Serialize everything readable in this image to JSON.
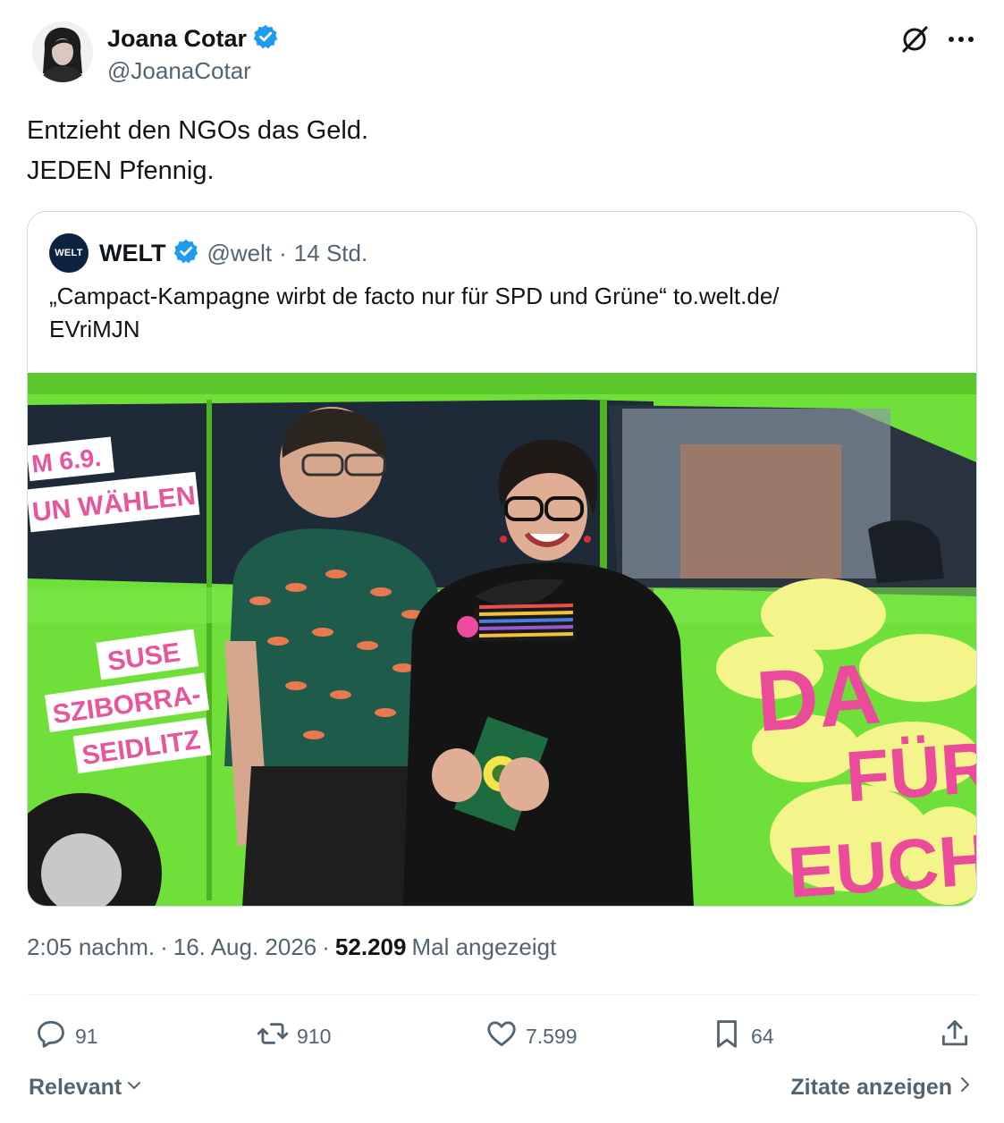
{
  "author": {
    "name": "Joana Cotar",
    "handle": "@JoanaCotar",
    "verified": true
  },
  "tweet": {
    "line1": "Entzieht den NGOs das Geld.",
    "line2": "JEDEN Pfennig."
  },
  "quoted": {
    "logo_text": "WELT",
    "name": "WELT",
    "handle": "@welt",
    "separator": "·",
    "age": "14 Std.",
    "text_line1": "„Campact-Kampagne wirbt de facto nur für SPD und Grüne“ to.welt.de/",
    "text_line2": "EVriMJN",
    "image": {
      "poster_date": "M 6.9.",
      "poster_vote": "UN WÄHLEN",
      "poster_name1": "SUSE",
      "poster_name2": "SZIBORRA-",
      "poster_name3": "SEIDLITZ",
      "slogan1": "DA",
      "slogan2": "FÜR",
      "slogan3": "EUCH."
    }
  },
  "meta": {
    "time": "2:05 nachm.",
    "sep1": "·",
    "date": "16. Aug. 2026",
    "sep2": "·",
    "views": "52.209",
    "views_label": "Mal angezeigt"
  },
  "actions": {
    "replies": "91",
    "reposts": "910",
    "likes": "7.599",
    "bookmarks": "64"
  },
  "footer": {
    "sort_label": "Relevant",
    "quotes_label": "Zitate anzeigen"
  },
  "colors": {
    "verified": "#1d9bf0",
    "secondary_text": "#536471",
    "car_green": "#6fe03a",
    "slogan_pink": "#ec4a9a",
    "sunflower_yellow": "#f3f58a"
  }
}
